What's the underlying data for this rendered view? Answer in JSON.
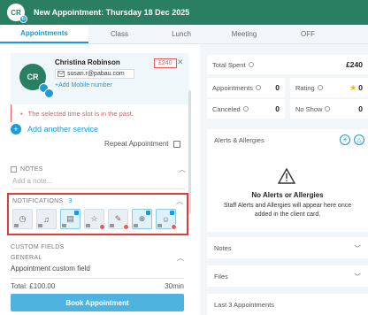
{
  "header": {
    "logo_initials": "CR",
    "title": "New Appointment: Thursday 18 Dec 2025"
  },
  "tabs": [
    {
      "label": "Appointments"
    },
    {
      "label": "Class"
    },
    {
      "label": "Lunch"
    },
    {
      "label": "Meeting"
    },
    {
      "label": "OFF"
    }
  ],
  "client": {
    "initials": "CR",
    "name": "Christina Robinson",
    "email": "susan.r@pabau.com",
    "add_mobile": "+Add Mobile number",
    "price_badge": "£240"
  },
  "error": "The selected time slot is in the past.",
  "add_service": "Add another service",
  "repeat": "Repeat Appointment",
  "notes": {
    "label": "NOTES",
    "placeholder": "Add a note..."
  },
  "notifications": {
    "label": "NOTIFICATIONS",
    "count": "3"
  },
  "custom_fields": {
    "label": "CUSTOM FIELDS",
    "general": "GENERAL",
    "general_sub": "Appointment custom field"
  },
  "total": {
    "label": "Total: £100.00",
    "duration": "30min"
  },
  "book_button": "Book Appointment",
  "stats": {
    "total_spent_label": "Total Spent",
    "total_spent": "£240",
    "appointments_label": "Appointments",
    "appointments": "0",
    "rating_label": "Rating",
    "rating": "0",
    "canceled_label": "Canceled",
    "canceled": "0",
    "noshow_label": "No Show",
    "noshow": "0"
  },
  "alerts": {
    "title": "Alerts & Allergies",
    "heading": "No Alerts or Allergies",
    "text": "Staff Alerts and Allergies will appear here once added in the client card."
  },
  "right_sections": {
    "notes": "Notes",
    "files": "Files",
    "last3": "Last 3 Appointments"
  },
  "colors": {
    "brand": "#2a7f62",
    "accent": "#1a9bd7",
    "error": "#e25a5a"
  }
}
